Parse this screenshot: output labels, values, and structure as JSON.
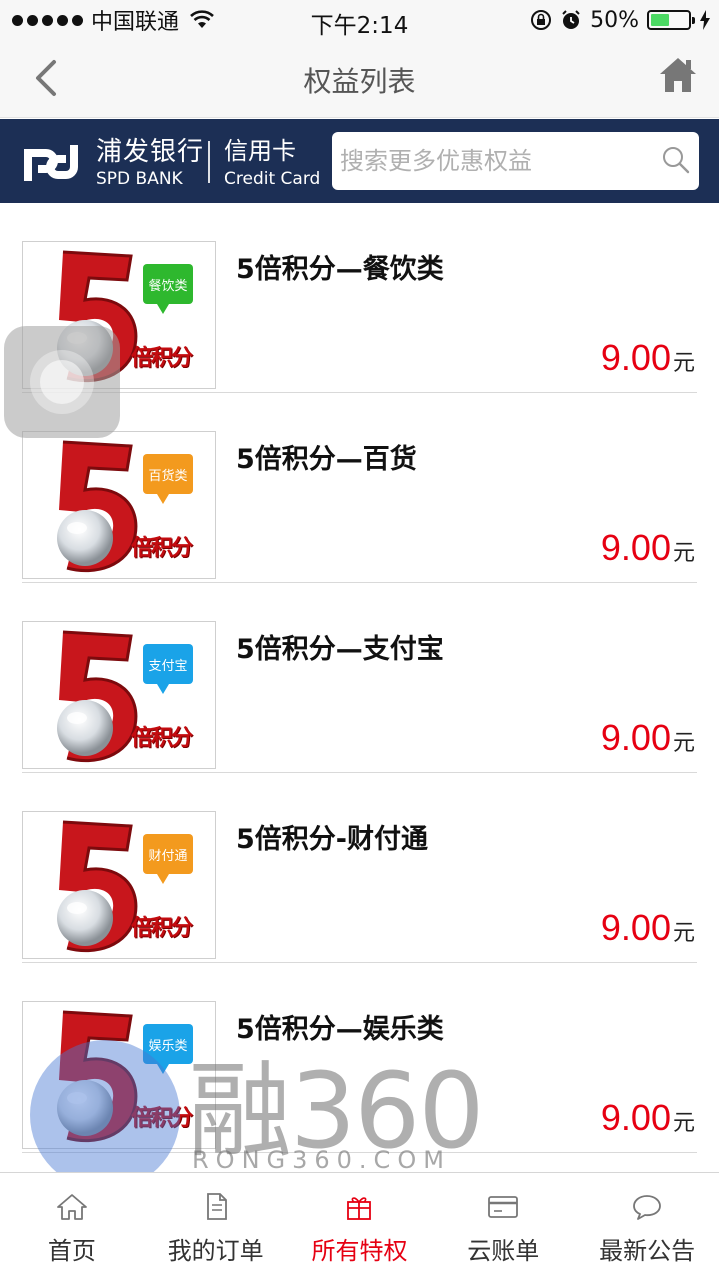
{
  "status_bar": {
    "carrier": "中国联通",
    "time": "下午2:14",
    "battery_percent": "50%",
    "battery_level": 0.5
  },
  "nav": {
    "title": "权益列表",
    "back_icon": "chevron-left-icon",
    "home_icon": "home-icon"
  },
  "brand": {
    "bank_cn": "浦发银行",
    "bank_en": "SPD BANK",
    "card_cn": "信用卡",
    "card_en": "Credit Card",
    "search_placeholder": "搜索更多优惠权益",
    "colors": {
      "banner": "#1c2f55"
    }
  },
  "products": [
    {
      "title": "5倍积分—餐饮类",
      "price": "9.00",
      "unit": "元",
      "thumb_tag": "餐饮类",
      "thumb_text": "倍积分",
      "tag_color": "#2eb82e"
    },
    {
      "title": "5倍积分—百货",
      "price": "9.00",
      "unit": "元",
      "thumb_tag": "百货类",
      "thumb_text": "倍积分",
      "tag_color": "#f39a1e"
    },
    {
      "title": "5倍积分—支付宝",
      "price": "9.00",
      "unit": "元",
      "thumb_tag": "支付宝",
      "thumb_text": "倍积分",
      "tag_color": "#1aa3e8"
    },
    {
      "title": "5倍积分-财付通",
      "price": "9.00",
      "unit": "元",
      "thumb_tag": "财付通",
      "thumb_text": "倍积分",
      "tag_color": "#f39a1e"
    },
    {
      "title": "5倍积分—娱乐类",
      "price": "9.00",
      "unit": "元",
      "thumb_tag": "娱乐类",
      "thumb_text": "倍积分",
      "tag_color": "#1aa3e8"
    }
  ],
  "watermark": {
    "text": "融360",
    "sub": "RONG360.COM"
  },
  "tabs": [
    {
      "label": "首页",
      "icon": "home-outline-icon",
      "active": false
    },
    {
      "label": "我的订单",
      "icon": "document-icon",
      "active": false
    },
    {
      "label": "所有特权",
      "icon": "gift-icon",
      "active": true
    },
    {
      "label": "云账单",
      "icon": "card-icon",
      "active": false
    },
    {
      "label": "最新公告",
      "icon": "chat-bubble-icon",
      "active": false
    }
  ],
  "colors": {
    "accent": "#e60012",
    "price": "#e60012"
  }
}
